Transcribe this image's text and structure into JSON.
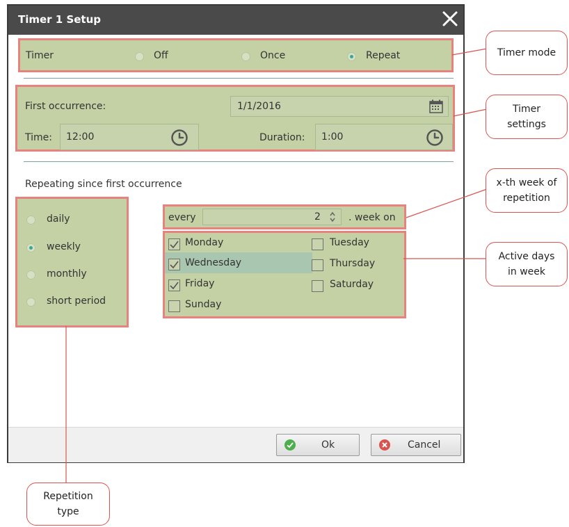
{
  "dialog": {
    "title": "Timer 1 Setup",
    "timer_mode": {
      "label": "Timer",
      "options": [
        "Off",
        "Once",
        "Repeat"
      ],
      "selected": "Repeat"
    },
    "settings": {
      "first_occurrence_label": "First occurrence:",
      "first_occurrence_value": "1/1/2016",
      "time_label": "Time:",
      "time_value": "12:00",
      "duration_label": "Duration:",
      "duration_value": "1:00"
    },
    "repeating_heading": "Repeating since first occurrence",
    "repetition_type": {
      "options": [
        "daily",
        "weekly",
        "monthly",
        "short period"
      ],
      "selected": "weekly"
    },
    "week_interval": {
      "prefix": "every",
      "value": "2",
      "suffix": ". week on"
    },
    "days": [
      {
        "label": "Monday",
        "checked": true
      },
      {
        "label": "Tuesday",
        "checked": false
      },
      {
        "label": "Wednesday",
        "checked": true
      },
      {
        "label": "Thursday",
        "checked": false
      },
      {
        "label": "Friday",
        "checked": true
      },
      {
        "label": "Saturday",
        "checked": false
      },
      {
        "label": "Sunday",
        "checked": false
      }
    ],
    "buttons": {
      "ok": "Ok",
      "cancel": "Cancel"
    }
  },
  "callouts": {
    "timer_mode": [
      "Timer mode"
    ],
    "timer_settings": [
      "Timer",
      "settings"
    ],
    "week_repetition": [
      "x-th week of",
      "repetition"
    ],
    "active_days": [
      "Active days",
      "in week"
    ],
    "repetition_type": [
      "Repetition",
      "type"
    ]
  },
  "colors": {
    "highlight_border": "#e8827e",
    "panel_green": "#c3d1a5",
    "titlebar": "#4a4a4a",
    "radio_selected": "#3aa79a"
  }
}
